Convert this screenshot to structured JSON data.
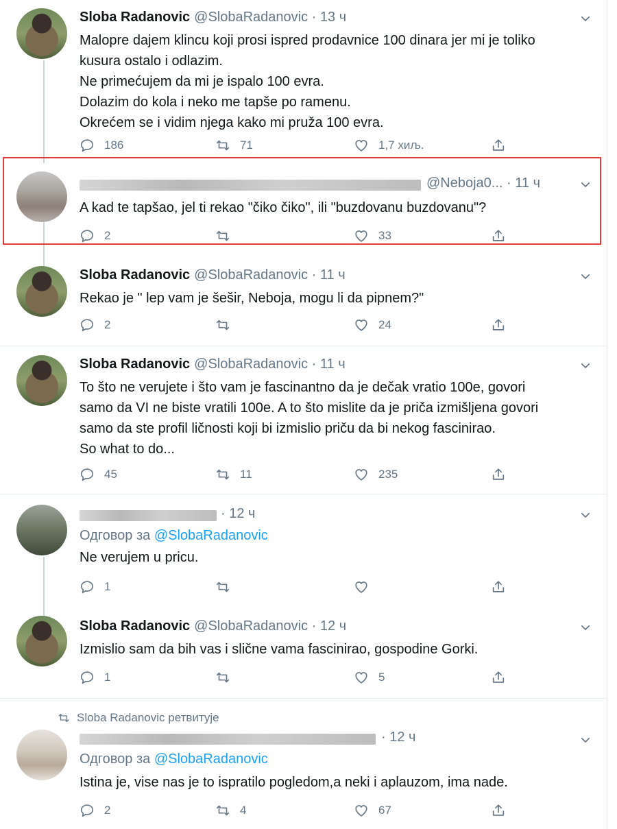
{
  "tweets": [
    {
      "name": "Sloba Radanovic",
      "handle": "@SlobaRadanovic",
      "time": "· 13 ч",
      "text": "Malopre dajem klincu koji prosi ispred prodavnice 100 dinara jer mi je toliko\nkusura ostalo i odlazim.\nNe primećujem da mi je ispalo 100 evra.\nDolazim do kola i neko me tapše po ramenu.\nOkrećem se i vidim njega kako mi pruža 100 evra.",
      "replies": "186",
      "retweets": "71",
      "likes": "1,7 хиљ."
    },
    {
      "name": "",
      "handle": "@Neboja0...",
      "time": "· 11 ч",
      "text": "A kad te tapšao, jel ti rekao \"čiko čiko\", ili \"buzdovanu buzdovanu\"?",
      "replies": "2",
      "retweets": "",
      "likes": "33"
    },
    {
      "name": "Sloba Radanovic",
      "handle": "@SlobaRadanovic",
      "time": "· 11 ч",
      "text": "Rekao je \" lep vam je šešir, Neboja, mogu li da pipnem?\"",
      "replies": "2",
      "retweets": "",
      "likes": "24"
    },
    {
      "name": "Sloba Radanovic",
      "handle": "@SlobaRadanovic",
      "time": "· 11 ч",
      "text": "To što ne verujete i što vam je fascinantno da je dečak vratio 100e, govori\nsamo da VI ne biste vratili 100e. A to što mislite da je priča izmišljena govori\nsamo da ste profil ličnosti koji bi izmislio priču da bi nekog fascinirao.\nSo what to do...",
      "replies": "45",
      "retweets": "11",
      "likes": "235"
    },
    {
      "name": "",
      "handle": "",
      "time": "· 12 ч",
      "reply_prefix": "Одговор за",
      "reply_to": "@SlobaRadanovic",
      "text": "Ne verujem u pricu.",
      "replies": "1",
      "retweets": "",
      "likes": ""
    },
    {
      "name": "Sloba Radanovic",
      "handle": "@SlobaRadanovic",
      "time": "· 12 ч",
      "text": "Izmislio sam da bih vas i slične vama fascinirao, gospodine Gorki.",
      "replies": "1",
      "retweets": "",
      "likes": "5"
    },
    {
      "retweeted_by": "Sloba Radanovic ретвитује",
      "name": "",
      "handle": "",
      "time": "· 12 ч",
      "reply_prefix": "Одговор за",
      "reply_to": "@SlobaRadanovic",
      "text": "Istina je, vise nas je to ispratilo pogledom,a neki i aplauzom, ima nade.",
      "replies": "2",
      "retweets": "4",
      "likes": "67"
    }
  ],
  "icons": {
    "reply": "reply-icon",
    "retweet": "retweet-icon",
    "like": "heart-icon",
    "share": "share-icon",
    "more": "chevron-down-icon"
  },
  "colors": {
    "text": "#14171a",
    "muted": "#657786",
    "link": "#1da1f2",
    "divider": "#e6ecf0",
    "highlight": "#e03c3c"
  }
}
